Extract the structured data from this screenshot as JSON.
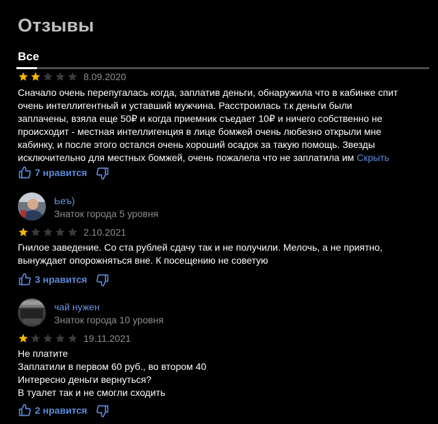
{
  "header": {
    "title": "Отзывы",
    "tab_all": "Все"
  },
  "colors": {
    "background": "#000000",
    "star_filled": "#f5b500",
    "star_empty": "#3a3a3a",
    "link": "#5b8bd9",
    "muted": "#8e8e8e"
  },
  "reviews": [
    {
      "rating": 2,
      "date": "8.09.2020",
      "lines": [
        "Сначало очень перепугалась когда, заплатив деньги, обнаружила что в кабинке спит",
        "очень интеллигентный и уставший мужчина. Расстроилась т.к деньги были",
        "заплачены, взяла еще 50₽ и когда приемник съедает 10₽ и ничего собственно не",
        "происходит - местная интеллигенция в лице бомжей очень любезно открыли мне",
        "кабинку, и после этого остался очень хороший осадок за такую помощь. Звезды",
        "исключительно для местных бомжей, очень пожалела что не заплатила им"
      ],
      "hide_label": "Скрыть",
      "likes_label": "7 нравится",
      "icons": {
        "like": "thumbs-up-icon",
        "dislike": "thumbs-down-icon"
      }
    },
    {
      "author": "Ьеъ)",
      "rank": "Знаток города 5 уровня",
      "rating": 1,
      "date": "2.10.2021",
      "lines": [
        "Гнилое заведение. Со ста рублей сдачу так и не получили. Мелочь, а не приятно,",
        "вынуждает опорожняться вне. К посещению не советую"
      ],
      "likes_label": "3 нравится",
      "icons": {
        "like": "thumbs-up-icon",
        "dislike": "thumbs-down-icon"
      }
    },
    {
      "author": "чай нужен",
      "rank": "Знаток города 10 уровня",
      "rating": 1,
      "date": "19.11.2021",
      "lines": [
        "Не платите",
        "Заплатили в первом 60 руб., во втором 40",
        "Интересно деньги вернуться?",
        "В туалет так и не смогли сходить"
      ],
      "likes_label": "2 нравится",
      "icons": {
        "like": "thumbs-up-icon",
        "dislike": "thumbs-down-icon"
      }
    }
  ]
}
